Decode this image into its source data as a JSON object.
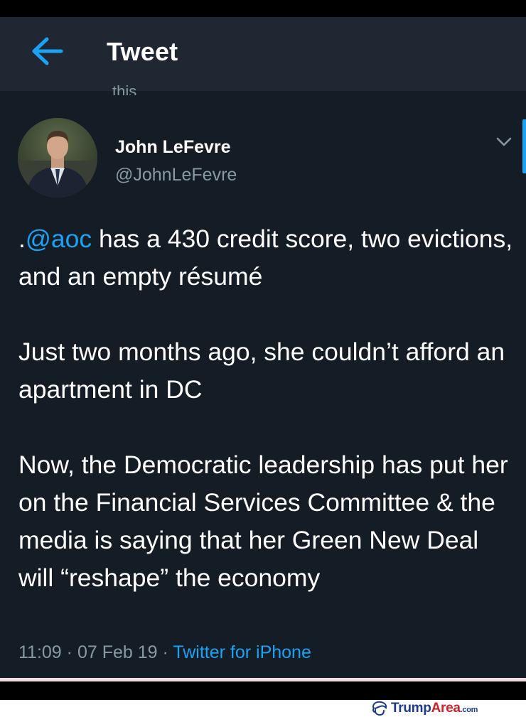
{
  "header": {
    "title": "Tweet"
  },
  "clipped_text": "this",
  "tweet": {
    "author": {
      "display_name": "John LeFevre",
      "handle": "@JohnLeFevre"
    },
    "paragraphs": [
      {
        "prefix": ".",
        "mention": "@aoc",
        "text": " has a 430 credit score, two evictions, and an empty résumé"
      },
      {
        "text": "Just two months ago, she couldn’t afford an apartment in DC"
      },
      {
        "text": "Now, the Democratic leadership has put her on the Financial Services Committee & the media is saying that her Green New Deal will “reshape” the economy"
      }
    ],
    "time": "11:09",
    "date": "07 Feb 19",
    "separator": "·",
    "source": "Twitter for iPhone"
  },
  "watermark": {
    "name_part1": "Trump",
    "name_part2": "Area",
    "suffix": ".com"
  },
  "colors": {
    "background": "#141d26",
    "header": "#1e2732",
    "accent": "#1da1f2",
    "secondary_text": "#8899a6"
  },
  "icons": {
    "back": "arrow-left-icon",
    "caret": "chevron-down-icon",
    "watermark_logo": "hair-logo-icon"
  }
}
